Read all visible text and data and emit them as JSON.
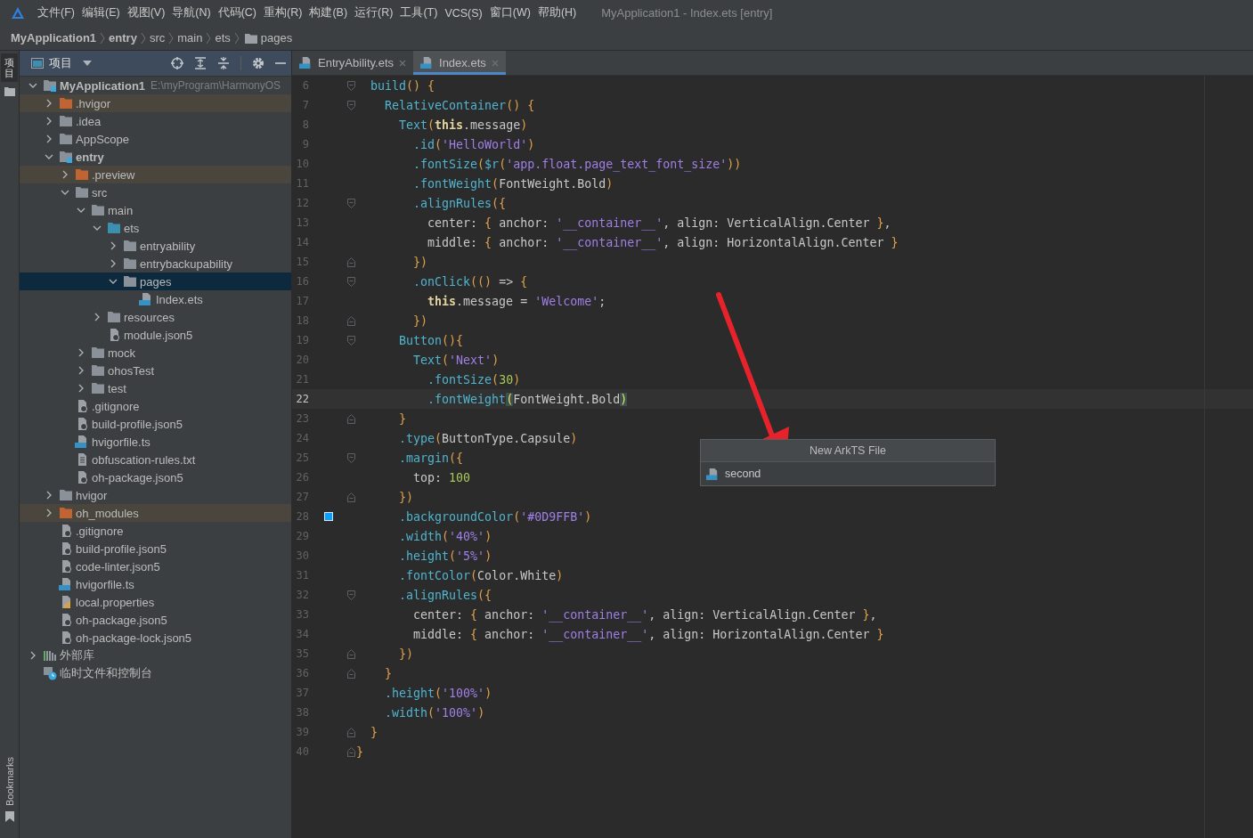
{
  "menu_bar": {
    "items": [
      "文件(F)",
      "编辑(E)",
      "视图(V)",
      "导航(N)",
      "代码(C)",
      "重构(R)",
      "构建(B)",
      "运行(R)",
      "工具(T)",
      "VCS(S)",
      "窗口(W)",
      "帮助(H)"
    ],
    "title": "MyApplication1 - Index.ets [entry]"
  },
  "breadcrumb": [
    {
      "label": "MyApplication1",
      "kind": "module"
    },
    {
      "label": "entry",
      "kind": "module"
    },
    {
      "label": "src",
      "kind": "dir"
    },
    {
      "label": "main",
      "kind": "dir"
    },
    {
      "label": "ets",
      "kind": "dir"
    },
    {
      "label": "pages",
      "kind": "folder"
    }
  ],
  "left_stripe": {
    "top_label": "项目",
    "bottom_label": "Bookmarks"
  },
  "project_panel": {
    "title": "项目",
    "tree": [
      {
        "label": "MyApplication1",
        "kind": "module",
        "path": "E:\\myProgram\\HarmonyOS",
        "expanded": true,
        "selected": false,
        "children": [
          {
            "label": ".hvigor",
            "kind": "excluded",
            "expanded": false,
            "selected": false
          },
          {
            "label": ".idea",
            "kind": "folder",
            "expanded": false,
            "selected": false
          },
          {
            "label": "AppScope",
            "kind": "folder",
            "expanded": false,
            "selected": false
          },
          {
            "label": "entry",
            "kind": "module",
            "expanded": true,
            "selected": false,
            "children": [
              {
                "label": ".preview",
                "kind": "excluded",
                "expanded": false,
                "selected": false
              },
              {
                "label": "src",
                "kind": "folder",
                "expanded": true,
                "selected": false,
                "children": [
                  {
                    "label": "main",
                    "kind": "folder",
                    "expanded": true,
                    "selected": false,
                    "children": [
                      {
                        "label": "ets",
                        "kind": "source",
                        "expanded": true,
                        "selected": false,
                        "children": [
                          {
                            "label": "entryability",
                            "kind": "folder",
                            "expanded": false,
                            "selected": false
                          },
                          {
                            "label": "entrybackupability",
                            "kind": "folder",
                            "expanded": false,
                            "selected": false
                          },
                          {
                            "label": "pages",
                            "kind": "folder",
                            "expanded": true,
                            "selected": true,
                            "children": [
                              {
                                "label": "Index.ets",
                                "kind": "ets",
                                "selected": false
                              }
                            ]
                          }
                        ]
                      },
                      {
                        "label": "resources",
                        "kind": "folder",
                        "expanded": false,
                        "selected": false
                      },
                      {
                        "label": "module.json5",
                        "kind": "json",
                        "selected": false
                      }
                    ]
                  },
                  {
                    "label": "mock",
                    "kind": "folder",
                    "expanded": false,
                    "selected": false
                  },
                  {
                    "label": "ohosTest",
                    "kind": "folder",
                    "expanded": false,
                    "selected": false
                  },
                  {
                    "label": "test",
                    "kind": "folder",
                    "expanded": false,
                    "selected": false
                  }
                ]
              },
              {
                "label": ".gitignore",
                "kind": "ignore",
                "selected": false
              },
              {
                "label": "build-profile.json5",
                "kind": "json",
                "selected": false
              },
              {
                "label": "hvigorfile.ts",
                "kind": "ts",
                "selected": false
              },
              {
                "label": "obfuscation-rules.txt",
                "kind": "txt",
                "selected": false
              },
              {
                "label": "oh-package.json5",
                "kind": "json",
                "selected": false
              }
            ]
          },
          {
            "label": "hvigor",
            "kind": "folder",
            "expanded": false,
            "selected": false
          },
          {
            "label": "oh_modules",
            "kind": "excluded",
            "expanded": false,
            "selected": false
          },
          {
            "label": ".gitignore",
            "kind": "ignore",
            "selected": false
          },
          {
            "label": "build-profile.json5",
            "kind": "json",
            "selected": false
          },
          {
            "label": "code-linter.json5",
            "kind": "json",
            "selected": false
          },
          {
            "label": "hvigorfile.ts",
            "kind": "ts",
            "selected": false
          },
          {
            "label": "local.properties",
            "kind": "props",
            "selected": false
          },
          {
            "label": "oh-package.json5",
            "kind": "json",
            "selected": false
          },
          {
            "label": "oh-package-lock.json5",
            "kind": "json",
            "selected": false
          }
        ]
      },
      {
        "label": "外部库",
        "kind": "library",
        "expanded": false,
        "selected": false
      },
      {
        "label": "临时文件和控制台",
        "kind": "scratch",
        "selected": false
      }
    ]
  },
  "editor": {
    "tabs": [
      {
        "label": "EntryAbility.ets",
        "selected": false
      },
      {
        "label": "Index.ets",
        "selected": true
      }
    ],
    "lines": [
      {
        "number": "6",
        "kind": "opener",
        "current": false,
        "tokens": [
          {
            "kind": "fn",
            "text": "  build"
          },
          {
            "kind": "br",
            "text": "() {"
          }
        ]
      },
      {
        "number": "7",
        "kind": "opener",
        "current": false,
        "tokens": [
          {
            "kind": "fn",
            "text": "    RelativeContainer"
          },
          {
            "kind": "br",
            "text": "() {"
          }
        ]
      },
      {
        "number": "8",
        "kind": "plain",
        "current": false,
        "tokens": [
          {
            "kind": "fn",
            "text": "      Text"
          },
          {
            "kind": "br",
            "text": "("
          },
          {
            "kind": "kw",
            "text": "this"
          },
          {
            "kind": "p",
            "text": ".message"
          },
          {
            "kind": "br",
            "text": ")"
          }
        ]
      },
      {
        "number": "9",
        "kind": "plain",
        "current": false,
        "tokens": [
          {
            "kind": "fn",
            "text": "        .id"
          },
          {
            "kind": "br",
            "text": "("
          },
          {
            "kind": "str",
            "text": "'HelloWorld'"
          },
          {
            "kind": "br",
            "text": ")"
          }
        ]
      },
      {
        "number": "10",
        "kind": "plain",
        "current": false,
        "tokens": [
          {
            "kind": "fn",
            "text": "        .fontSize"
          },
          {
            "kind": "br",
            "text": "("
          },
          {
            "kind": "fn",
            "text": "$r"
          },
          {
            "kind": "br",
            "text": "("
          },
          {
            "kind": "str",
            "text": "'app.float.page_text_font_size'"
          },
          {
            "kind": "br",
            "text": "))"
          }
        ]
      },
      {
        "number": "11",
        "kind": "plain",
        "current": false,
        "tokens": [
          {
            "kind": "fn",
            "text": "        .fontWeight"
          },
          {
            "kind": "br",
            "text": "("
          },
          {
            "kind": "p",
            "text": "FontWeight.Bold"
          },
          {
            "kind": "br",
            "text": ")"
          }
        ]
      },
      {
        "number": "12",
        "kind": "opener",
        "current": false,
        "tokens": [
          {
            "kind": "fn",
            "text": "        .alignRules"
          },
          {
            "kind": "br",
            "text": "({"
          }
        ]
      },
      {
        "number": "13",
        "kind": "plain",
        "current": false,
        "tokens": [
          {
            "kind": "p",
            "text": "          center: "
          },
          {
            "kind": "br",
            "text": "{"
          },
          {
            "kind": "p",
            "text": " anchor: "
          },
          {
            "kind": "str",
            "text": "'__container__'"
          },
          {
            "kind": "p",
            "text": ", align: VerticalAlign.Center "
          },
          {
            "kind": "br",
            "text": "}"
          },
          {
            "kind": "p",
            "text": ","
          }
        ]
      },
      {
        "number": "14",
        "kind": "plain",
        "current": false,
        "tokens": [
          {
            "kind": "p",
            "text": "          middle: "
          },
          {
            "kind": "br",
            "text": "{"
          },
          {
            "kind": "p",
            "text": " anchor: "
          },
          {
            "kind": "str",
            "text": "'__container__'"
          },
          {
            "kind": "p",
            "text": ", align: HorizontalAlign.Center "
          },
          {
            "kind": "br",
            "text": "}"
          }
        ]
      },
      {
        "number": "15",
        "kind": "closer",
        "current": false,
        "tokens": [
          {
            "kind": "br",
            "text": "        })"
          }
        ]
      },
      {
        "number": "16",
        "kind": "opener",
        "current": false,
        "tokens": [
          {
            "kind": "fn",
            "text": "        .onClick"
          },
          {
            "kind": "br",
            "text": "(()"
          },
          {
            "kind": "p",
            "text": " => "
          },
          {
            "kind": "br",
            "text": "{"
          }
        ]
      },
      {
        "number": "17",
        "kind": "plain",
        "current": false,
        "tokens": [
          {
            "kind": "kw",
            "text": "          this"
          },
          {
            "kind": "p",
            "text": ".message = "
          },
          {
            "kind": "str",
            "text": "'Welcome'"
          },
          {
            "kind": "p",
            "text": ";"
          }
        ]
      },
      {
        "number": "18",
        "kind": "closer",
        "current": false,
        "tokens": [
          {
            "kind": "br",
            "text": "        })"
          }
        ]
      },
      {
        "number": "19",
        "kind": "opener",
        "current": false,
        "tokens": [
          {
            "kind": "fn",
            "text": "      Button"
          },
          {
            "kind": "br",
            "text": "(){"
          }
        ]
      },
      {
        "number": "20",
        "kind": "plain",
        "current": false,
        "tokens": [
          {
            "kind": "fn",
            "text": "        Text"
          },
          {
            "kind": "br",
            "text": "("
          },
          {
            "kind": "str",
            "text": "'Next'"
          },
          {
            "kind": "br",
            "text": ")"
          }
        ]
      },
      {
        "number": "21",
        "kind": "plain",
        "current": false,
        "tokens": [
          {
            "kind": "fn",
            "text": "          .fontSize"
          },
          {
            "kind": "br",
            "text": "("
          },
          {
            "kind": "num",
            "text": "30"
          },
          {
            "kind": "br",
            "text": ")"
          }
        ]
      },
      {
        "number": "22",
        "kind": "plain",
        "current": true,
        "tokens": [
          {
            "kind": "fn",
            "text": "          .fontWeight"
          },
          {
            "kind": "bm",
            "text": "("
          },
          {
            "kind": "p",
            "text": "FontWeight.Bold"
          },
          {
            "kind": "bm",
            "text": ")"
          }
        ]
      },
      {
        "number": "23",
        "kind": "closer",
        "current": false,
        "tokens": [
          {
            "kind": "br",
            "text": "      }"
          }
        ]
      },
      {
        "number": "24",
        "kind": "plain",
        "current": false,
        "tokens": [
          {
            "kind": "fn",
            "text": "      .type"
          },
          {
            "kind": "br",
            "text": "("
          },
          {
            "kind": "p",
            "text": "ButtonType.Capsule"
          },
          {
            "kind": "br",
            "text": ")"
          }
        ]
      },
      {
        "number": "25",
        "kind": "opener",
        "current": false,
        "tokens": [
          {
            "kind": "fn",
            "text": "      .margin"
          },
          {
            "kind": "br",
            "text": "({"
          }
        ]
      },
      {
        "number": "26",
        "kind": "plain",
        "current": false,
        "tokens": [
          {
            "kind": "p",
            "text": "        top: "
          },
          {
            "kind": "num",
            "text": "100"
          }
        ]
      },
      {
        "number": "27",
        "kind": "closer",
        "current": false,
        "tokens": [
          {
            "kind": "br",
            "text": "      })"
          }
        ]
      },
      {
        "number": "28",
        "kind": "plain",
        "color": "#0d9ffb",
        "current": false,
        "tokens": [
          {
            "kind": "fn",
            "text": "      .backgroundColor"
          },
          {
            "kind": "br",
            "text": "("
          },
          {
            "kind": "str",
            "text": "'#0D9FFB'"
          },
          {
            "kind": "br",
            "text": ")"
          }
        ]
      },
      {
        "number": "29",
        "kind": "plain",
        "current": false,
        "tokens": [
          {
            "kind": "fn",
            "text": "      .width"
          },
          {
            "kind": "br",
            "text": "("
          },
          {
            "kind": "str",
            "text": "'40%'"
          },
          {
            "kind": "br",
            "text": ")"
          }
        ]
      },
      {
        "number": "30",
        "kind": "plain",
        "current": false,
        "tokens": [
          {
            "kind": "fn",
            "text": "      .height"
          },
          {
            "kind": "br",
            "text": "("
          },
          {
            "kind": "str",
            "text": "'5%'"
          },
          {
            "kind": "br",
            "text": ")"
          }
        ]
      },
      {
        "number": "31",
        "kind": "plain",
        "current": false,
        "tokens": [
          {
            "kind": "fn",
            "text": "      .fontColor"
          },
          {
            "kind": "br",
            "text": "("
          },
          {
            "kind": "p",
            "text": "Color.White"
          },
          {
            "kind": "br",
            "text": ")"
          }
        ]
      },
      {
        "number": "32",
        "kind": "opener",
        "current": false,
        "tokens": [
          {
            "kind": "fn",
            "text": "      .alignRules"
          },
          {
            "kind": "br",
            "text": "({"
          }
        ]
      },
      {
        "number": "33",
        "kind": "plain",
        "current": false,
        "tokens": [
          {
            "kind": "p",
            "text": "        center: "
          },
          {
            "kind": "br",
            "text": "{"
          },
          {
            "kind": "p",
            "text": " anchor: "
          },
          {
            "kind": "str",
            "text": "'__container__'"
          },
          {
            "kind": "p",
            "text": ", align: VerticalAlign.Center "
          },
          {
            "kind": "br",
            "text": "}"
          },
          {
            "kind": "p",
            "text": ","
          }
        ]
      },
      {
        "number": "34",
        "kind": "plain",
        "current": false,
        "tokens": [
          {
            "kind": "p",
            "text": "        middle: "
          },
          {
            "kind": "br",
            "text": "{"
          },
          {
            "kind": "p",
            "text": " anchor: "
          },
          {
            "kind": "str",
            "text": "'__container__'"
          },
          {
            "kind": "p",
            "text": ", align: HorizontalAlign.Center "
          },
          {
            "kind": "br",
            "text": "}"
          }
        ]
      },
      {
        "number": "35",
        "kind": "closer",
        "current": false,
        "tokens": [
          {
            "kind": "br",
            "text": "      })"
          }
        ]
      },
      {
        "number": "36",
        "kind": "closer",
        "current": false,
        "tokens": [
          {
            "kind": "br",
            "text": "    }"
          }
        ]
      },
      {
        "number": "37",
        "kind": "plain",
        "current": false,
        "tokens": [
          {
            "kind": "fn",
            "text": "    .height"
          },
          {
            "kind": "br",
            "text": "("
          },
          {
            "kind": "str",
            "text": "'100%'"
          },
          {
            "kind": "br",
            "text": ")"
          }
        ]
      },
      {
        "number": "38",
        "kind": "plain",
        "current": false,
        "tokens": [
          {
            "kind": "fn",
            "text": "    .width"
          },
          {
            "kind": "br",
            "text": "("
          },
          {
            "kind": "str",
            "text": "'100%'"
          },
          {
            "kind": "br",
            "text": ")"
          }
        ]
      },
      {
        "number": "39",
        "kind": "closer",
        "current": false,
        "tokens": [
          {
            "kind": "br",
            "text": "  }"
          }
        ]
      },
      {
        "number": "40",
        "kind": "closer",
        "current": false,
        "tokens": [
          {
            "kind": "br",
            "text": "}"
          }
        ]
      }
    ]
  },
  "popup": {
    "title": "New ArkTS File",
    "items": [
      {
        "label": "second"
      }
    ]
  }
}
